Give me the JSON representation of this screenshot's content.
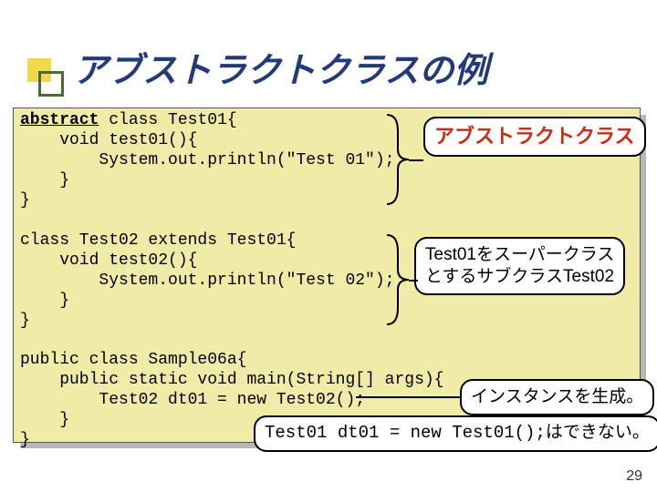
{
  "title": "アブストラクトクラスの例",
  "code_keyword": "abstract",
  "code": " class Test01{\n    void test01(){\n        System.out.println(\"Test 01\");\n    }\n}\n\nclass Test02 extends Test01{\n    void test02(){\n        System.out.println(\"Test 02\");\n    }\n}\n\npublic class Sample06a{\n    public static void main(String[] args){\n        Test02 dt01 = new Test02();\n    }\n}",
  "callouts": {
    "abstract_class": "アブストラクトクラス",
    "subclass_line1": "Test01をスーパークラス",
    "subclass_line2": "とするサブクラスTest02",
    "instance": "インスタンスを生成。",
    "note": "Test01 dt01 = new Test01();はできない。"
  },
  "page_number": "29"
}
